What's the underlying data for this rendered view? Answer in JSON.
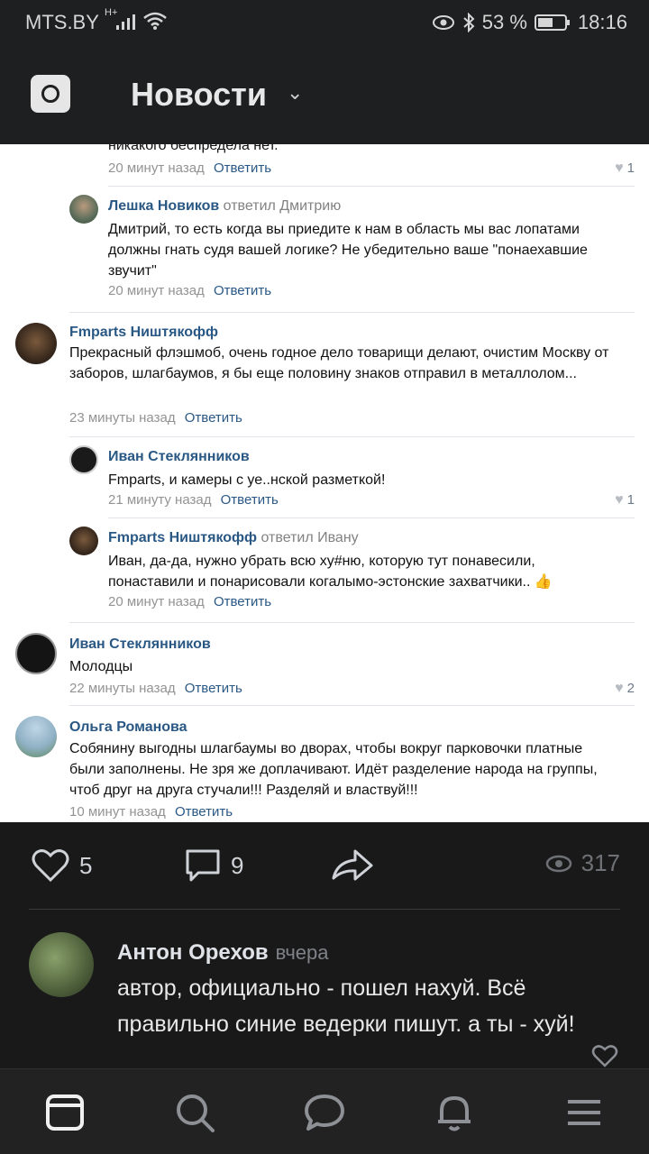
{
  "status_bar": {
    "carrier": "MTS.BY",
    "network": "H+",
    "battery": "53 %",
    "time": "18:16"
  },
  "header": {
    "title": "Новости"
  },
  "screenshot_comments": {
    "top_partial": {
      "text": "никакого беспредела нет.",
      "time": "20 минут назад",
      "reply": "Ответить",
      "likes": "1"
    },
    "c1": {
      "name": "Лешка Новиков",
      "replied": "ответил Дмитрию",
      "text": "Дмитрий, то есть когда вы приедите к нам в область мы вас лопатами должны гнать судя вашей логике? Не убедительно ваше \"понаехавшие звучит\"",
      "time": "20 минут назад",
      "reply": "Ответить"
    },
    "c2": {
      "name": "Fmparts Ништякофф",
      "text": "Прекрасный флэшмоб, очень годное дело товарищи делают, очистим Москву от заборов, шлагбаумов, я бы еще половину знаков отправил в металлолом...",
      "time": "23 минуты назад",
      "reply": "Ответить"
    },
    "c3": {
      "name": "Иван Стеклянников",
      "text": "Fmparts, и камеры с уе..нской разметкой!",
      "time": "21 минуту назад",
      "reply": "Ответить",
      "likes": "1"
    },
    "c4": {
      "name": "Fmparts Ништякофф",
      "replied": "ответил Ивану",
      "text": "Иван, да-да, нужно убрать всю ху#ню, которую тут понавесили, понаставили и понарисовали когалымо-эстонские захватчики..",
      "emoji": "👍",
      "time": "20 минут назад",
      "reply": "Ответить"
    },
    "c5": {
      "name": "Иван Стеклянников",
      "text": "Молодцы",
      "time": "22 минуты назад",
      "reply": "Ответить",
      "likes": "2"
    },
    "c6": {
      "name": "Ольга Романова",
      "text": "Собянину выгодны шлагбаумы во дворах, чтобы вокруг парковочки платные были заполнены. Не зря же доплачивают. Идёт разделение народа на группы, чтоб друг на друга стучали!!! Разделяй и властвуй!!!",
      "time": "10 минут назад",
      "reply": "Ответить"
    }
  },
  "actions": {
    "likes": "5",
    "comments": "9",
    "views": "317"
  },
  "comment": {
    "author": "Антон Орехов",
    "when": "вчера",
    "text": "автор, официально - пошел нахуй. Всё правильно синие ведерки пишут. а ты - хуй!"
  },
  "icons": {
    "like": "heart-icon",
    "comment": "comment-icon",
    "share": "share-icon",
    "views": "eye-icon",
    "tabs": [
      "news-tab-icon",
      "search-icon",
      "messages-icon",
      "notifications-icon",
      "menu-icon"
    ]
  }
}
